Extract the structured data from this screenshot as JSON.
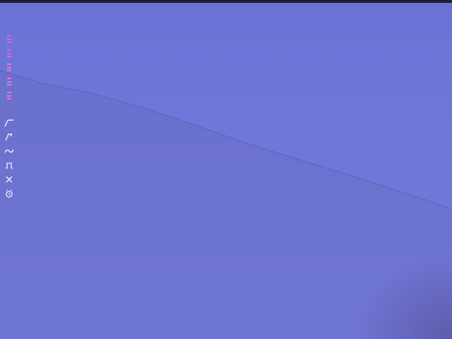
{
  "colors": {
    "sky": "#6b74d8",
    "slope": "#6c73cf",
    "ridge_line": "#4f55a8",
    "top_bar": "#1b1c3a",
    "accent_magenta": "#d86ad0",
    "accent_pink": "#e07ad8",
    "icon_white": "#f2f0ff"
  },
  "toolbar": {
    "level_bars": [
      {
        "name": "level-bar-1",
        "color": "#d86ad0"
      },
      {
        "name": "level-bar-2",
        "color": "#d86ad0"
      },
      {
        "name": "level-bar-3",
        "color": "#e07ad8"
      },
      {
        "name": "level-bar-4",
        "color": "#e07ad8"
      },
      {
        "name": "level-bar-5",
        "color": "#e07ad8"
      }
    ],
    "tools": [
      {
        "name": "curve-ramp-icon"
      },
      {
        "name": "line-up-icon"
      },
      {
        "name": "wave-icon"
      },
      {
        "name": "pulse-icon"
      },
      {
        "name": "close-icon"
      },
      {
        "name": "alarm-clock-icon"
      }
    ]
  }
}
